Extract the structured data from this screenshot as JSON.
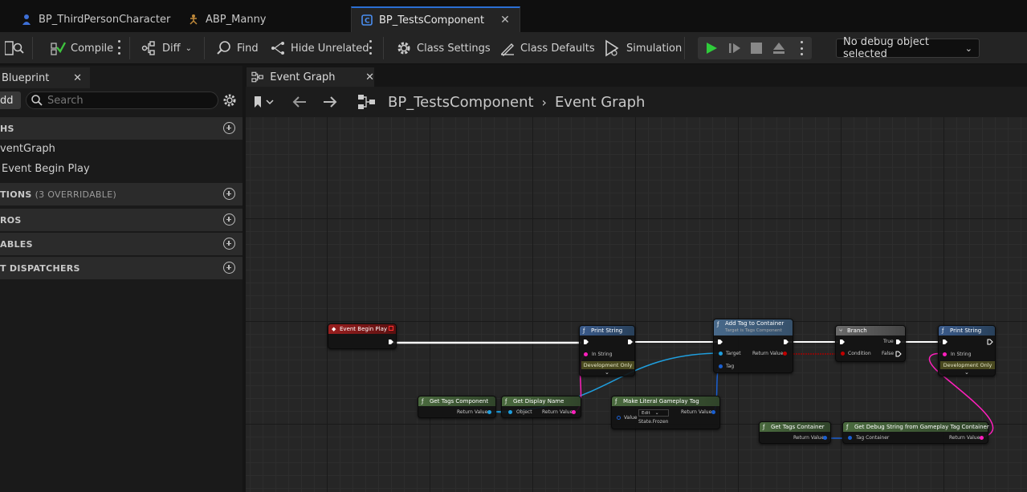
{
  "tabs": [
    {
      "label": "BP_ThirdPersonCharacter",
      "active": false
    },
    {
      "label": "ABP_Manny",
      "active": false
    },
    {
      "label": "BP_TestsComponent",
      "active": true
    }
  ],
  "toolbar": {
    "compile": "Compile",
    "diff": "Diff",
    "find": "Find",
    "hide_unrelated": "Hide Unrelated",
    "class_settings": "Class Settings",
    "class_defaults": "Class Defaults",
    "simulation": "Simulation",
    "debug_object": "No debug object selected"
  },
  "left_panel": {
    "tab_label": "Blueprint",
    "add_label": "dd",
    "search_placeholder": "Search",
    "sections": [
      {
        "label": "HS",
        "extra": ""
      },
      {
        "label": "TIONS",
        "extra": "(3 OVERRIDABLE)"
      },
      {
        "label": "ROS",
        "extra": ""
      },
      {
        "label": "ABLES",
        "extra": ""
      },
      {
        "label": "T DISPATCHERS",
        "extra": ""
      }
    ],
    "graphs_items": [
      "ventGraph",
      "Event Begin Play"
    ]
  },
  "graph": {
    "tab_label": "Event Graph",
    "breadcrumb_root": "BP_TestsComponent",
    "breadcrumb_leaf": "Event Graph",
    "nodes": {
      "event_begin_play": "Event Begin Play",
      "print_string_1": {
        "title": "Print String",
        "in_string": "In String",
        "dev_only": "Development Only"
      },
      "add_tag": {
        "title": "Add Tag to Container",
        "subtitle": "Target is Tags Component",
        "target": "Target",
        "tag": "Tag",
        "return": "Return Value"
      },
      "branch": {
        "title": "Branch",
        "true": "True",
        "false": "False",
        "condition": "Condition"
      },
      "print_string_2": {
        "title": "Print String",
        "in_string": "In String",
        "dev_only": "Development Only"
      },
      "get_tags_component": {
        "title": "Get Tags Component",
        "return": "Return Value"
      },
      "get_display_name": {
        "title": "Get Display Name",
        "object": "Object",
        "return": "Return Value"
      },
      "make_literal_tag": {
        "title": "Make Literal Gameplay Tag",
        "value": "Value",
        "edit": "Edit",
        "tag_value": "State.Frozen",
        "return": "Return Value"
      },
      "get_tags_container": {
        "title": "Get Tags Container",
        "return": "Return Value"
      },
      "get_debug_string": {
        "title": "Get Debug String from Gameplay Tag Container",
        "tag_container": "Tag Container",
        "return": "Return Value"
      }
    }
  },
  "colors": {
    "accent_blue": "#2b6fd4",
    "event_red": "#8a1a1a",
    "function_green": "#3c5a32",
    "pure_green": "#46603c",
    "target_blue": "#3a5c80",
    "exec_white": "#ffffff",
    "string_pink": "#ff1fbd",
    "object_blue": "#1f9fdf",
    "struct_blue": "#1a5fd0",
    "bool_red": "#a00000"
  }
}
